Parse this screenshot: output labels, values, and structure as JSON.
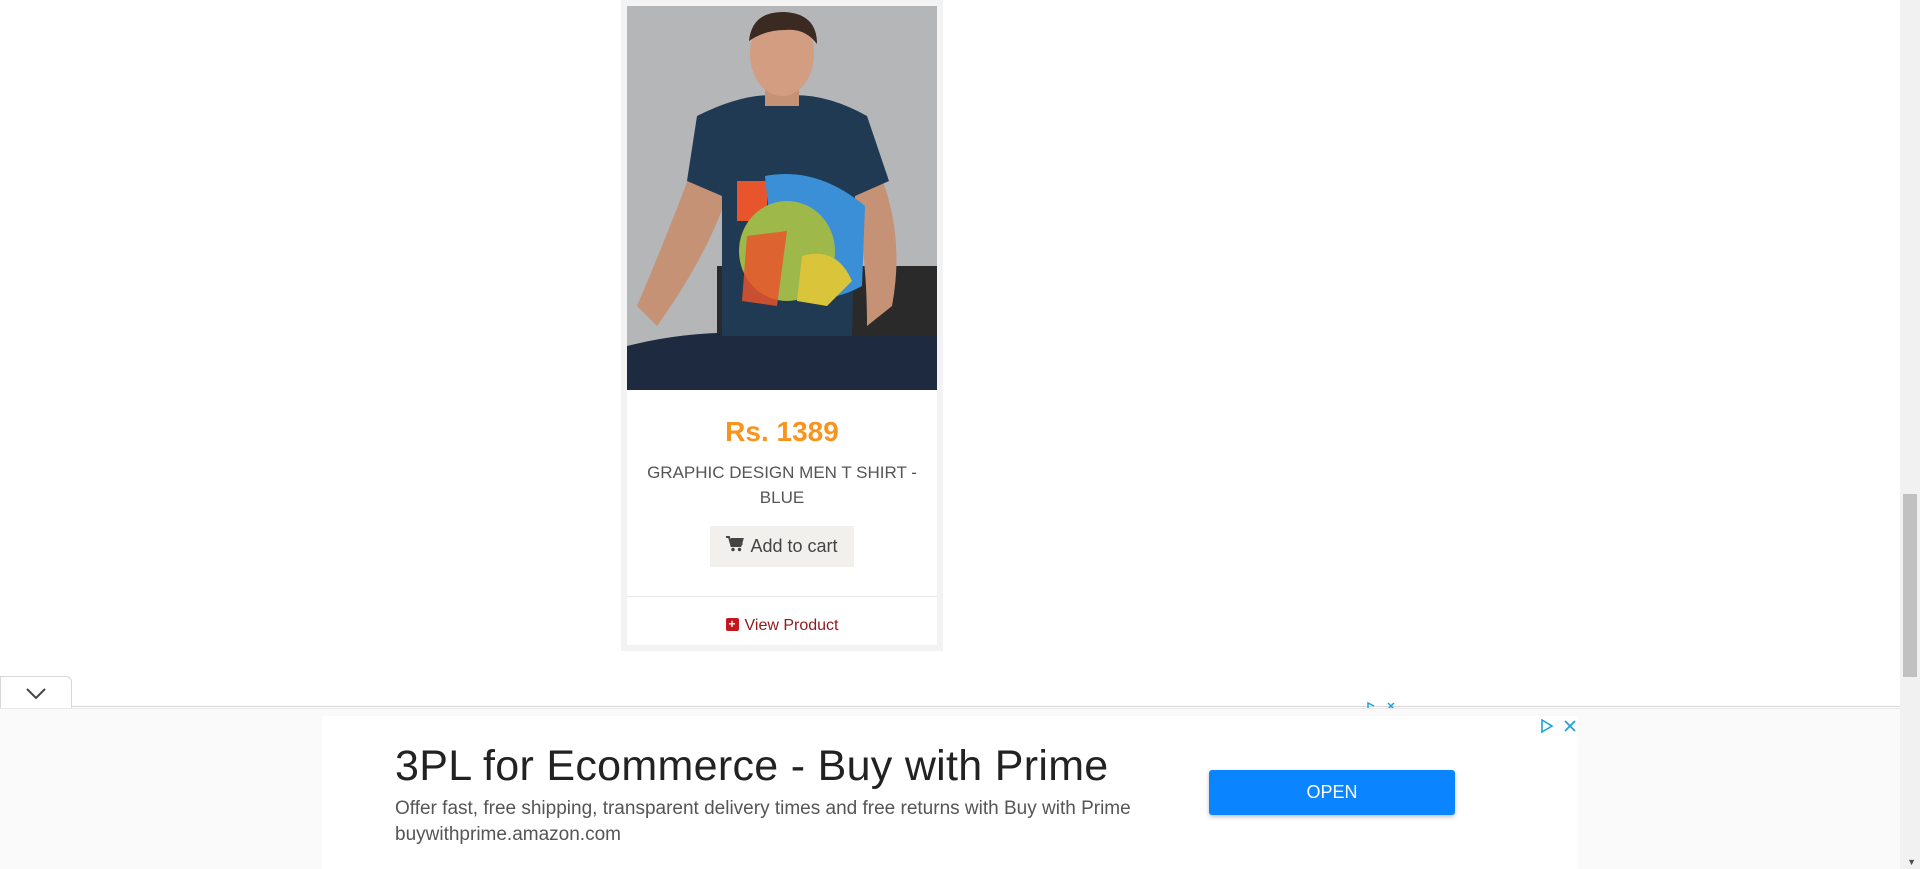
{
  "product": {
    "image_alt": "Man wearing navy graphic t-shirt",
    "price": "Rs. 1389",
    "name": "GRAPHIC DESIGN MEN T SHIRT - BLUE",
    "add_to_cart_label": "Add to cart",
    "view_product_label": "View Product",
    "price_color": "#f7941d",
    "link_color": "#8f1b1b"
  },
  "ad": {
    "title": "3PL for Ecommerce - Buy with Prime",
    "description": "Offer fast, free shipping, transparent delivery times and free returns with Buy with Prime buywithprime.amazon.com",
    "open_label": "OPEN",
    "button_color": "#0a84ff"
  },
  "icons": {
    "cart": "cart-icon",
    "plus": "plus-square-icon",
    "collapse": "chevron-down-icon",
    "ad_choices": "ad-choices-icon",
    "close": "close-icon"
  }
}
